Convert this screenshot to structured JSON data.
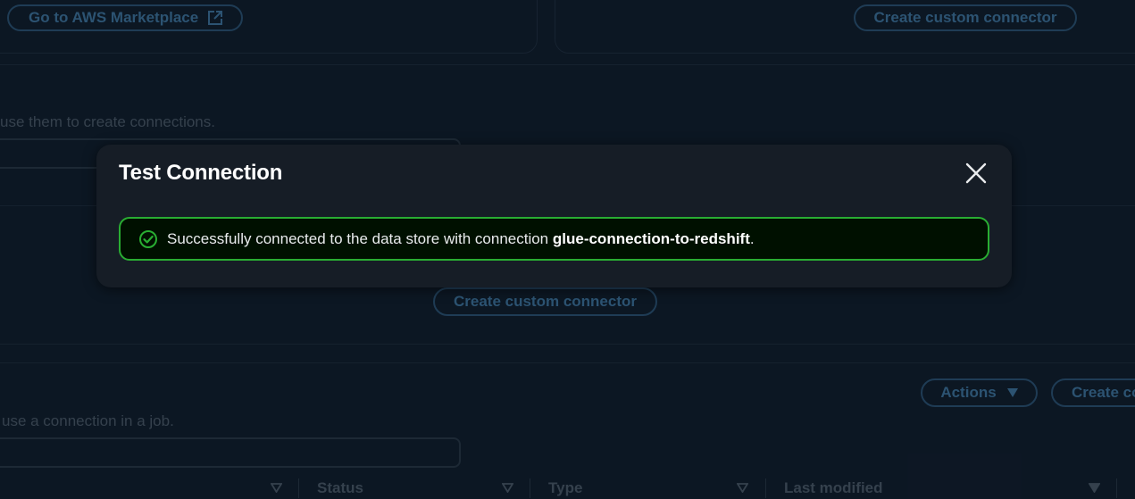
{
  "background": {
    "marketplace_button": "Go to AWS Marketplace",
    "create_custom_connector_top": "Create custom connector",
    "connectors_description": "use them to create connections.",
    "create_custom_connector_middle": "Create custom connector",
    "actions_button": "Actions",
    "create_connection_button": "Create co",
    "connections_description": "use a connection in a job.",
    "table_columns": [
      "Status",
      "Type",
      "Last modified"
    ]
  },
  "modal": {
    "title": "Test Connection",
    "close_icon": "close-icon",
    "flash": {
      "type": "success",
      "icon": "success-check-icon",
      "message_prefix": "Successfully connected to the data store with connection ",
      "connection_name": "glue-connection-to-redshift",
      "message_suffix": "."
    }
  },
  "colors": {
    "page_background": "#0f1b2a",
    "modal_background": "#161d26",
    "success_border": "#29ad32",
    "success_background": "#001000",
    "dim_link": "#3f77a3"
  }
}
